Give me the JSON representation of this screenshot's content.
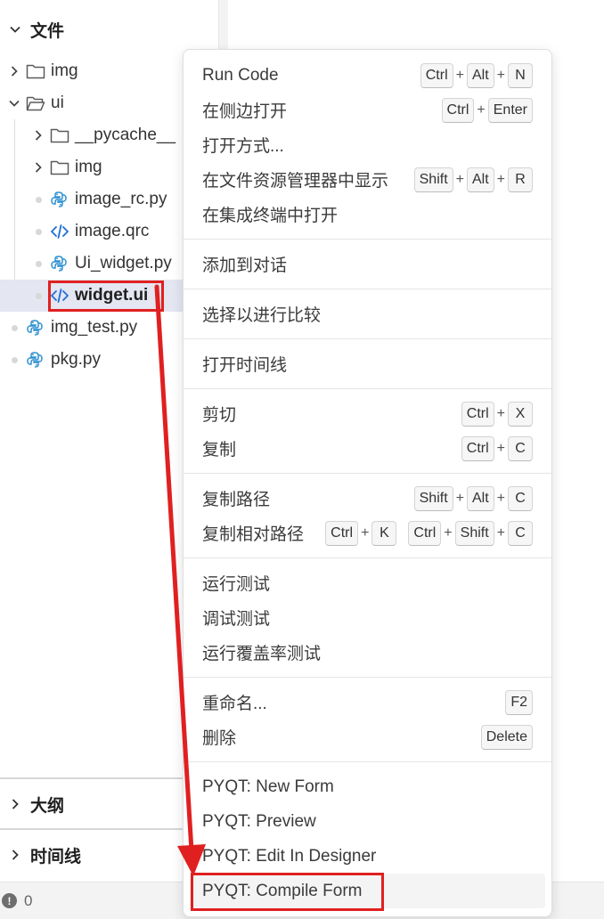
{
  "explorer": {
    "files_title": "文件",
    "tree": [
      {
        "label": "img",
        "type": "folder",
        "level": 0,
        "expanded": false
      },
      {
        "label": "ui",
        "type": "folder",
        "level": 0,
        "expanded": true
      },
      {
        "label": "__pycache__",
        "type": "folder",
        "level": 1,
        "expanded": false
      },
      {
        "label": "img",
        "type": "folder",
        "level": 1,
        "expanded": false
      },
      {
        "label": "image_rc.py",
        "type": "python",
        "level": 1
      },
      {
        "label": "image.qrc",
        "type": "code",
        "level": 1
      },
      {
        "label": "Ui_widget.py",
        "type": "python",
        "level": 1
      },
      {
        "label": "widget.ui",
        "type": "code",
        "level": 1,
        "selected": true
      },
      {
        "label": "img_test.py",
        "type": "python",
        "level": 0
      },
      {
        "label": "pkg.py",
        "type": "python",
        "level": 0
      }
    ],
    "outline_title": "大纲",
    "timeline_title": "时间线"
  },
  "statusbar": {
    "problems_count": "0"
  },
  "context_menu": {
    "groups": [
      [
        {
          "label": "Run Code",
          "shortcut": [
            [
              "Ctrl",
              "Alt",
              "N"
            ]
          ]
        },
        {
          "label": "在侧边打开",
          "shortcut": [
            [
              "Ctrl",
              "Enter"
            ]
          ]
        },
        {
          "label": "打开方式...",
          "shortcut": []
        },
        {
          "label": "在文件资源管理器中显示",
          "shortcut": [
            [
              "Shift",
              "Alt",
              "R"
            ]
          ]
        },
        {
          "label": "在集成终端中打开",
          "shortcut": []
        }
      ],
      [
        {
          "label": "添加到对话",
          "shortcut": []
        }
      ],
      [
        {
          "label": "选择以进行比较",
          "shortcut": []
        }
      ],
      [
        {
          "label": "打开时间线",
          "shortcut": []
        }
      ],
      [
        {
          "label": "剪切",
          "shortcut": [
            [
              "Ctrl",
              "X"
            ]
          ]
        },
        {
          "label": "复制",
          "shortcut": [
            [
              "Ctrl",
              "C"
            ]
          ]
        }
      ],
      [
        {
          "label": "复制路径",
          "shortcut": [
            [
              "Shift",
              "Alt",
              "C"
            ]
          ]
        },
        {
          "label": "复制相对路径",
          "shortcut": [
            [
              "Ctrl",
              "K"
            ],
            [
              "Ctrl",
              "Shift",
              "C"
            ]
          ]
        }
      ],
      [
        {
          "label": "运行测试",
          "shortcut": []
        },
        {
          "label": "调试测试",
          "shortcut": []
        },
        {
          "label": "运行覆盖率测试",
          "shortcut": []
        }
      ],
      [
        {
          "label": "重命名...",
          "shortcut": [
            [
              "F2"
            ]
          ]
        },
        {
          "label": "删除",
          "shortcut": [
            [
              "Delete"
            ]
          ]
        }
      ],
      [
        {
          "label": "PYQT: New Form",
          "shortcut": []
        },
        {
          "label": "PYQT: Preview",
          "shortcut": []
        },
        {
          "label": "PYQT: Edit In Designer",
          "shortcut": []
        },
        {
          "label": "PYQT: Compile Form",
          "shortcut": [],
          "highlighted": true
        }
      ]
    ]
  },
  "annotation": {
    "color": "#e02020"
  }
}
